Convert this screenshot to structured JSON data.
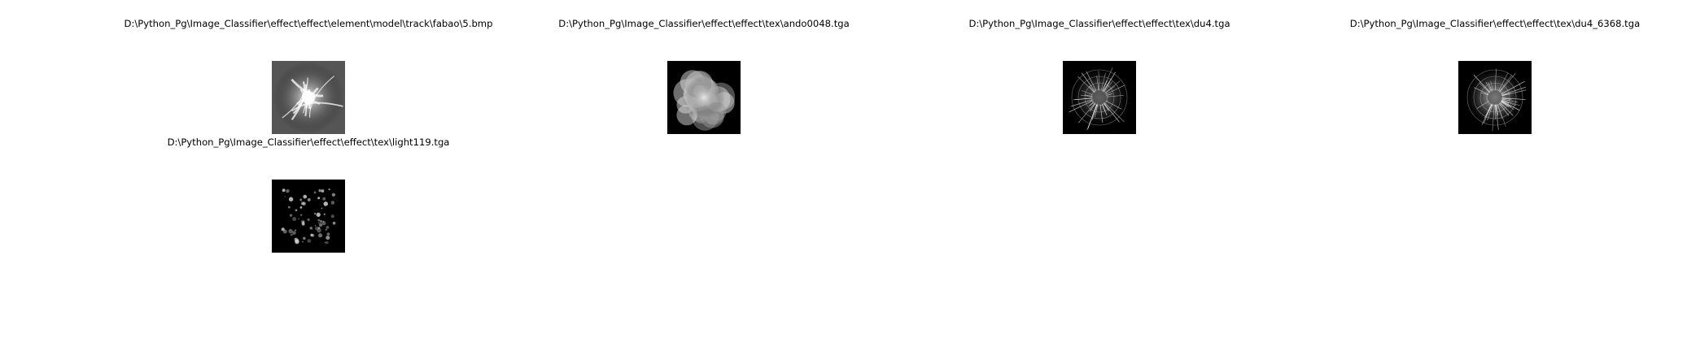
{
  "images": [
    {
      "caption": "D:\\Python_Pg\\Image_Classifier\\effect\\effect\\element\\model\\track\\fabao\\5.bmp",
      "pattern": "swirl",
      "accent": "#ffffff"
    },
    {
      "caption": "D:\\Python_Pg\\Image_Classifier\\effect\\effect\\tex\\ando0048.tga",
      "pattern": "cloud",
      "accent": "#e8e8e8"
    },
    {
      "caption": "D:\\Python_Pg\\Image_Classifier\\effect\\effect\\tex\\du4.tga",
      "pattern": "web",
      "accent": "#d0d0d0"
    },
    {
      "caption": "D:\\Python_Pg\\Image_Classifier\\effect\\effect\\tex\\du4_6368.tga",
      "pattern": "web-bright",
      "accent": "#f0f0f0"
    },
    {
      "caption": "D:\\Python_Pg\\Image_Classifier\\effect\\effect\\tex\\light119.tga",
      "pattern": "speckle",
      "accent": "#9a9a9a"
    }
  ]
}
